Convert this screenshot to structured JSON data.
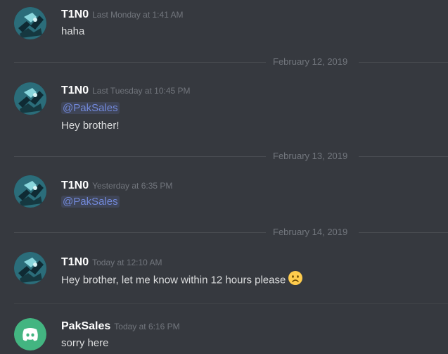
{
  "messages": [
    {
      "username": "T1N0",
      "timestamp": "Last Monday at 1:41 AM",
      "text": "haha"
    },
    {
      "divider": "February 12, 2019",
      "username": "T1N0",
      "timestamp": "Last Tuesday at 10:45 PM",
      "mention": "@PakSales",
      "text": "Hey brother!"
    },
    {
      "divider": "February 13, 2019",
      "username": "T1N0",
      "timestamp": "Yesterday at 6:35 PM",
      "mention": "@PakSales"
    },
    {
      "divider": "February 14, 2019",
      "username": "T1N0",
      "timestamp": "Today at 12:10 AM",
      "text": "Hey brother, let me know within 12 hours please",
      "emoji": "frowning-face-emoji"
    },
    {
      "username": "PakSales",
      "timestamp": "Today at 6:16 PM",
      "text": "sorry here"
    }
  ],
  "icons": {
    "tino_avatar": "anime-character-avatar",
    "paksales_avatar": "discord-logo-avatar"
  },
  "colors": {
    "background": "#36393f",
    "username": "#ffffff",
    "timestamp": "#72767d",
    "mention_text": "#7289da",
    "discord_blurple": "#43b581"
  }
}
